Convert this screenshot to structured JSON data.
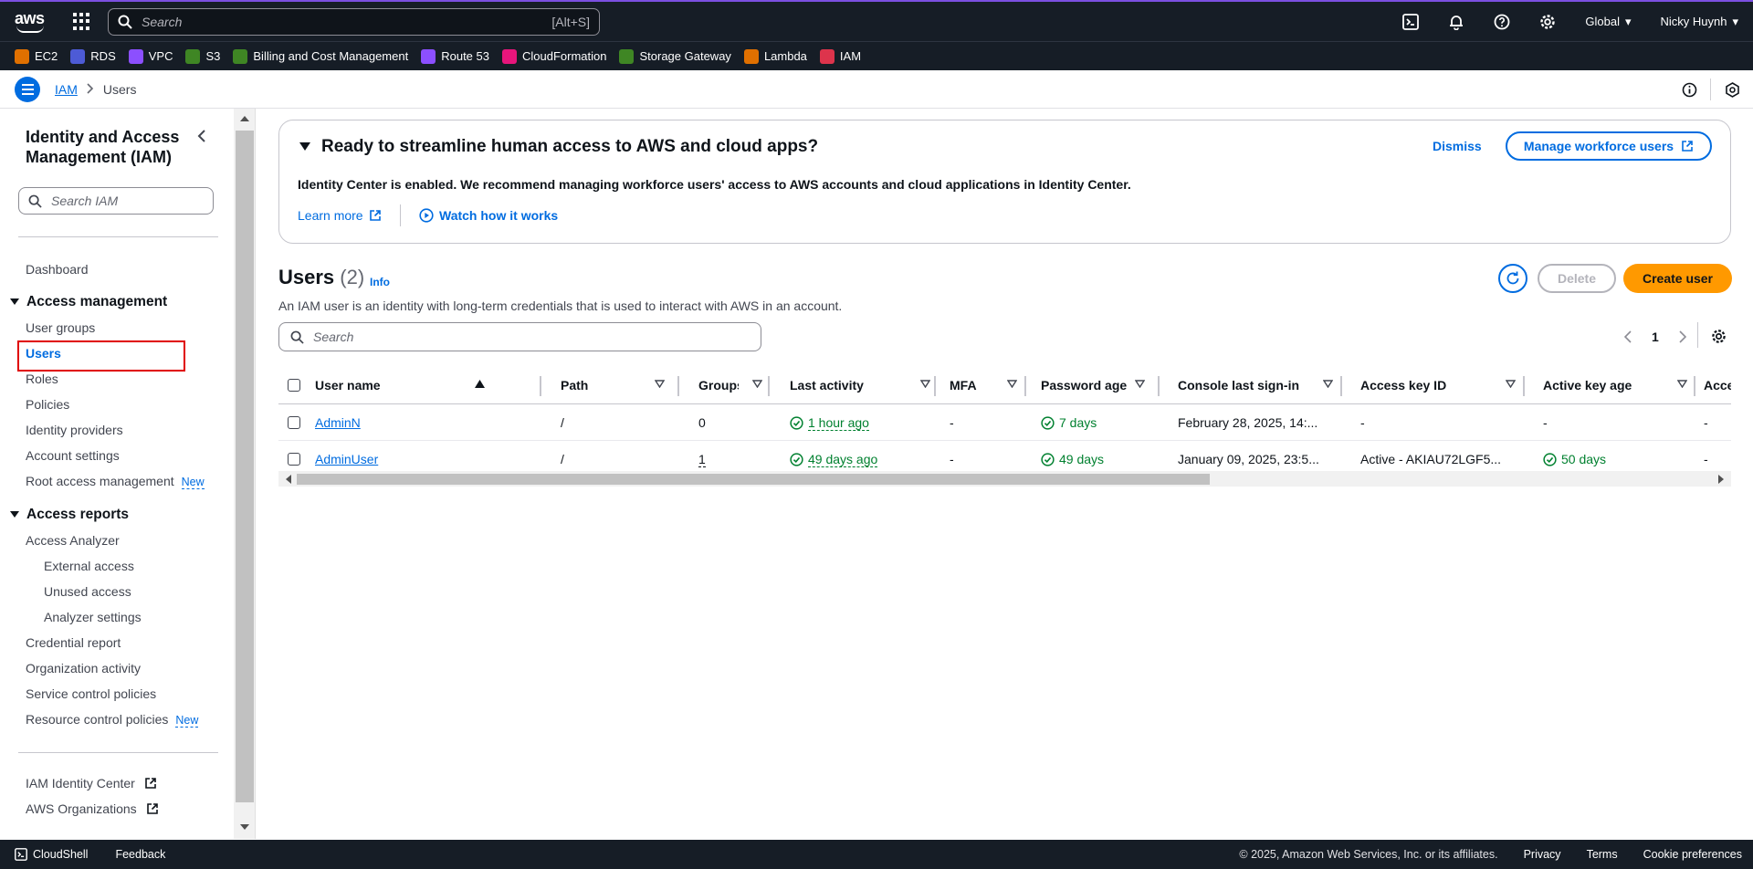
{
  "topnav": {
    "logo_text": "aws",
    "search_placeholder": "Search",
    "search_shortcut": "[Alt+S]",
    "region": "Global",
    "user": "Nicky Huynh"
  },
  "favorites": [
    {
      "label": "EC2",
      "color": "#e07000"
    },
    {
      "label": "RDS",
      "color": "#4d5bd6"
    },
    {
      "label": "VPC",
      "color": "#8c4fff"
    },
    {
      "label": "S3",
      "color": "#3f8624"
    },
    {
      "label": "Billing and Cost Management",
      "color": "#3f8624"
    },
    {
      "label": "Route 53",
      "color": "#8c4fff"
    },
    {
      "label": "CloudFormation",
      "color": "#e7157b"
    },
    {
      "label": "Storage Gateway",
      "color": "#3f8624"
    },
    {
      "label": "Lambda",
      "color": "#e07000"
    },
    {
      "label": "IAM",
      "color": "#dd344c"
    }
  ],
  "breadcrumb": {
    "root": "IAM",
    "current": "Users"
  },
  "sidebar": {
    "title": "Identity and Access Management (IAM)",
    "search_placeholder": "Search IAM",
    "dashboard": "Dashboard",
    "access_management": "Access management",
    "user_groups": "User groups",
    "users": "Users",
    "roles": "Roles",
    "policies": "Policies",
    "identity_providers": "Identity providers",
    "account_settings": "Account settings",
    "root_access": "Root access management",
    "new_badge": "New",
    "access_reports": "Access reports",
    "access_analyzer": "Access Analyzer",
    "external_access": "External access",
    "unused_access": "Unused access",
    "analyzer_settings": "Analyzer settings",
    "credential_report": "Credential report",
    "organization_activity": "Organization activity",
    "scp": "Service control policies",
    "rcp": "Resource control policies",
    "iam_identity_center": "IAM Identity Center",
    "aws_organizations": "AWS Organizations"
  },
  "banner": {
    "title": "Ready to streamline human access to AWS and cloud apps?",
    "desc": "Identity Center is enabled. We recommend managing workforce users' access to AWS accounts and cloud applications in Identity Center.",
    "learn_more": "Learn more",
    "watch": "Watch how it works",
    "dismiss": "Dismiss",
    "manage": "Manage workforce users"
  },
  "users": {
    "title": "Users",
    "count": "(2)",
    "info": "Info",
    "desc": "An IAM user is an identity with long-term credentials that is used to interact with AWS in an account.",
    "delete": "Delete",
    "create": "Create user",
    "search_placeholder": "Search",
    "page": "1"
  },
  "table": {
    "headers": {
      "user_name": "User name",
      "path": "Path",
      "groups": "Groups",
      "last_activity": "Last activity",
      "mfa": "MFA",
      "password_age": "Password age",
      "console_last_signin": "Console last sign-in",
      "access_key_id": "Access key ID",
      "active_key_age": "Active key age",
      "access_key_last_used": "Acce"
    },
    "rows": [
      {
        "user_name": "AdminN",
        "path": "/",
        "groups": "0",
        "last_activity": "1 hour ago",
        "mfa": "-",
        "password_age": "7 days",
        "console_last_signin": "February 28, 2025, 14:...",
        "access_key_id": "-",
        "active_key_age": "-",
        "access_key_last_used": "-"
      },
      {
        "user_name": "AdminUser",
        "path": "/",
        "groups": "1",
        "last_activity": "49 days ago",
        "mfa": "-",
        "password_age": "49 days",
        "console_last_signin": "January 09, 2025, 23:5...",
        "access_key_id": "Active - AKIAU72LGF5...",
        "active_key_age": "50 days",
        "access_key_last_used": "-"
      }
    ]
  },
  "footer": {
    "cloudshell": "CloudShell",
    "feedback": "Feedback",
    "copyright": "© 2025, Amazon Web Services, Inc. or its affiliates.",
    "privacy": "Privacy",
    "terms": "Terms",
    "cookie": "Cookie preferences"
  }
}
